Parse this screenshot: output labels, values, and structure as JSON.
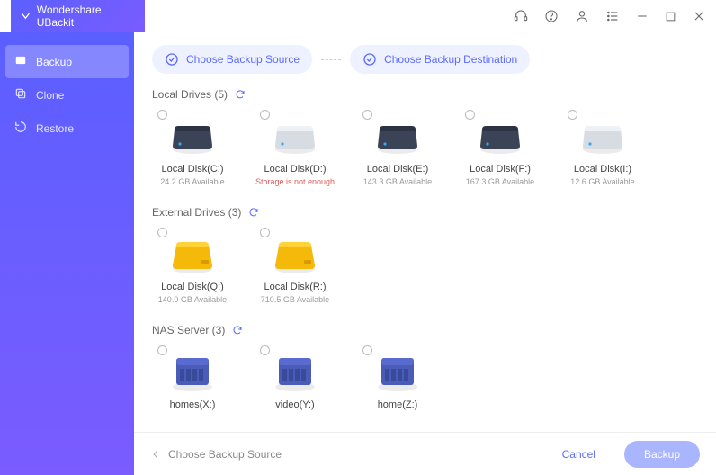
{
  "app": {
    "title": "Wondershare UBackit"
  },
  "titlebar_icons": [
    "headset-icon",
    "help-icon",
    "user-icon",
    "list-icon",
    "minimize-icon",
    "maximize-icon",
    "close-icon"
  ],
  "sidebar": {
    "items": [
      {
        "icon": "backup-icon",
        "label": "Backup",
        "active": true
      },
      {
        "icon": "clone-icon",
        "label": "Clone",
        "active": false
      },
      {
        "icon": "restore-icon",
        "label": "Restore",
        "active": false
      }
    ]
  },
  "steps": {
    "source": "Choose Backup Source",
    "destination": "Choose Backup Destination"
  },
  "sections": [
    {
      "title": "Local Drives",
      "count": 5,
      "kind": "hdd",
      "drives": [
        {
          "label": "Local Disk(C:)",
          "sub": "24.2 GB Available",
          "color": "dark"
        },
        {
          "label": "Local Disk(D:)",
          "sub": "Storage is not enough",
          "err": true,
          "color": "light"
        },
        {
          "label": "Local Disk(E:)",
          "sub": "143.3 GB Available",
          "color": "dark"
        },
        {
          "label": "Local Disk(F:)",
          "sub": "167.3 GB Available",
          "color": "dark"
        },
        {
          "label": "Local Disk(I:)",
          "sub": "12.6 GB Available",
          "color": "light"
        }
      ]
    },
    {
      "title": "External Drives",
      "count": 3,
      "kind": "ext",
      "drives": [
        {
          "label": "Local Disk(Q:)",
          "sub": "140.0 GB Available"
        },
        {
          "label": "Local Disk(R:)",
          "sub": "710.5 GB Available"
        }
      ]
    },
    {
      "title": "NAS Server",
      "count": 3,
      "kind": "nas",
      "drives": [
        {
          "label": "homes(X:)",
          "sub": ""
        },
        {
          "label": "video(Y:)",
          "sub": ""
        },
        {
          "label": "home(Z:)",
          "sub": ""
        }
      ]
    }
  ],
  "footer": {
    "hint": "Choose Backup Source",
    "cancel": "Cancel",
    "primary": "Backup"
  }
}
